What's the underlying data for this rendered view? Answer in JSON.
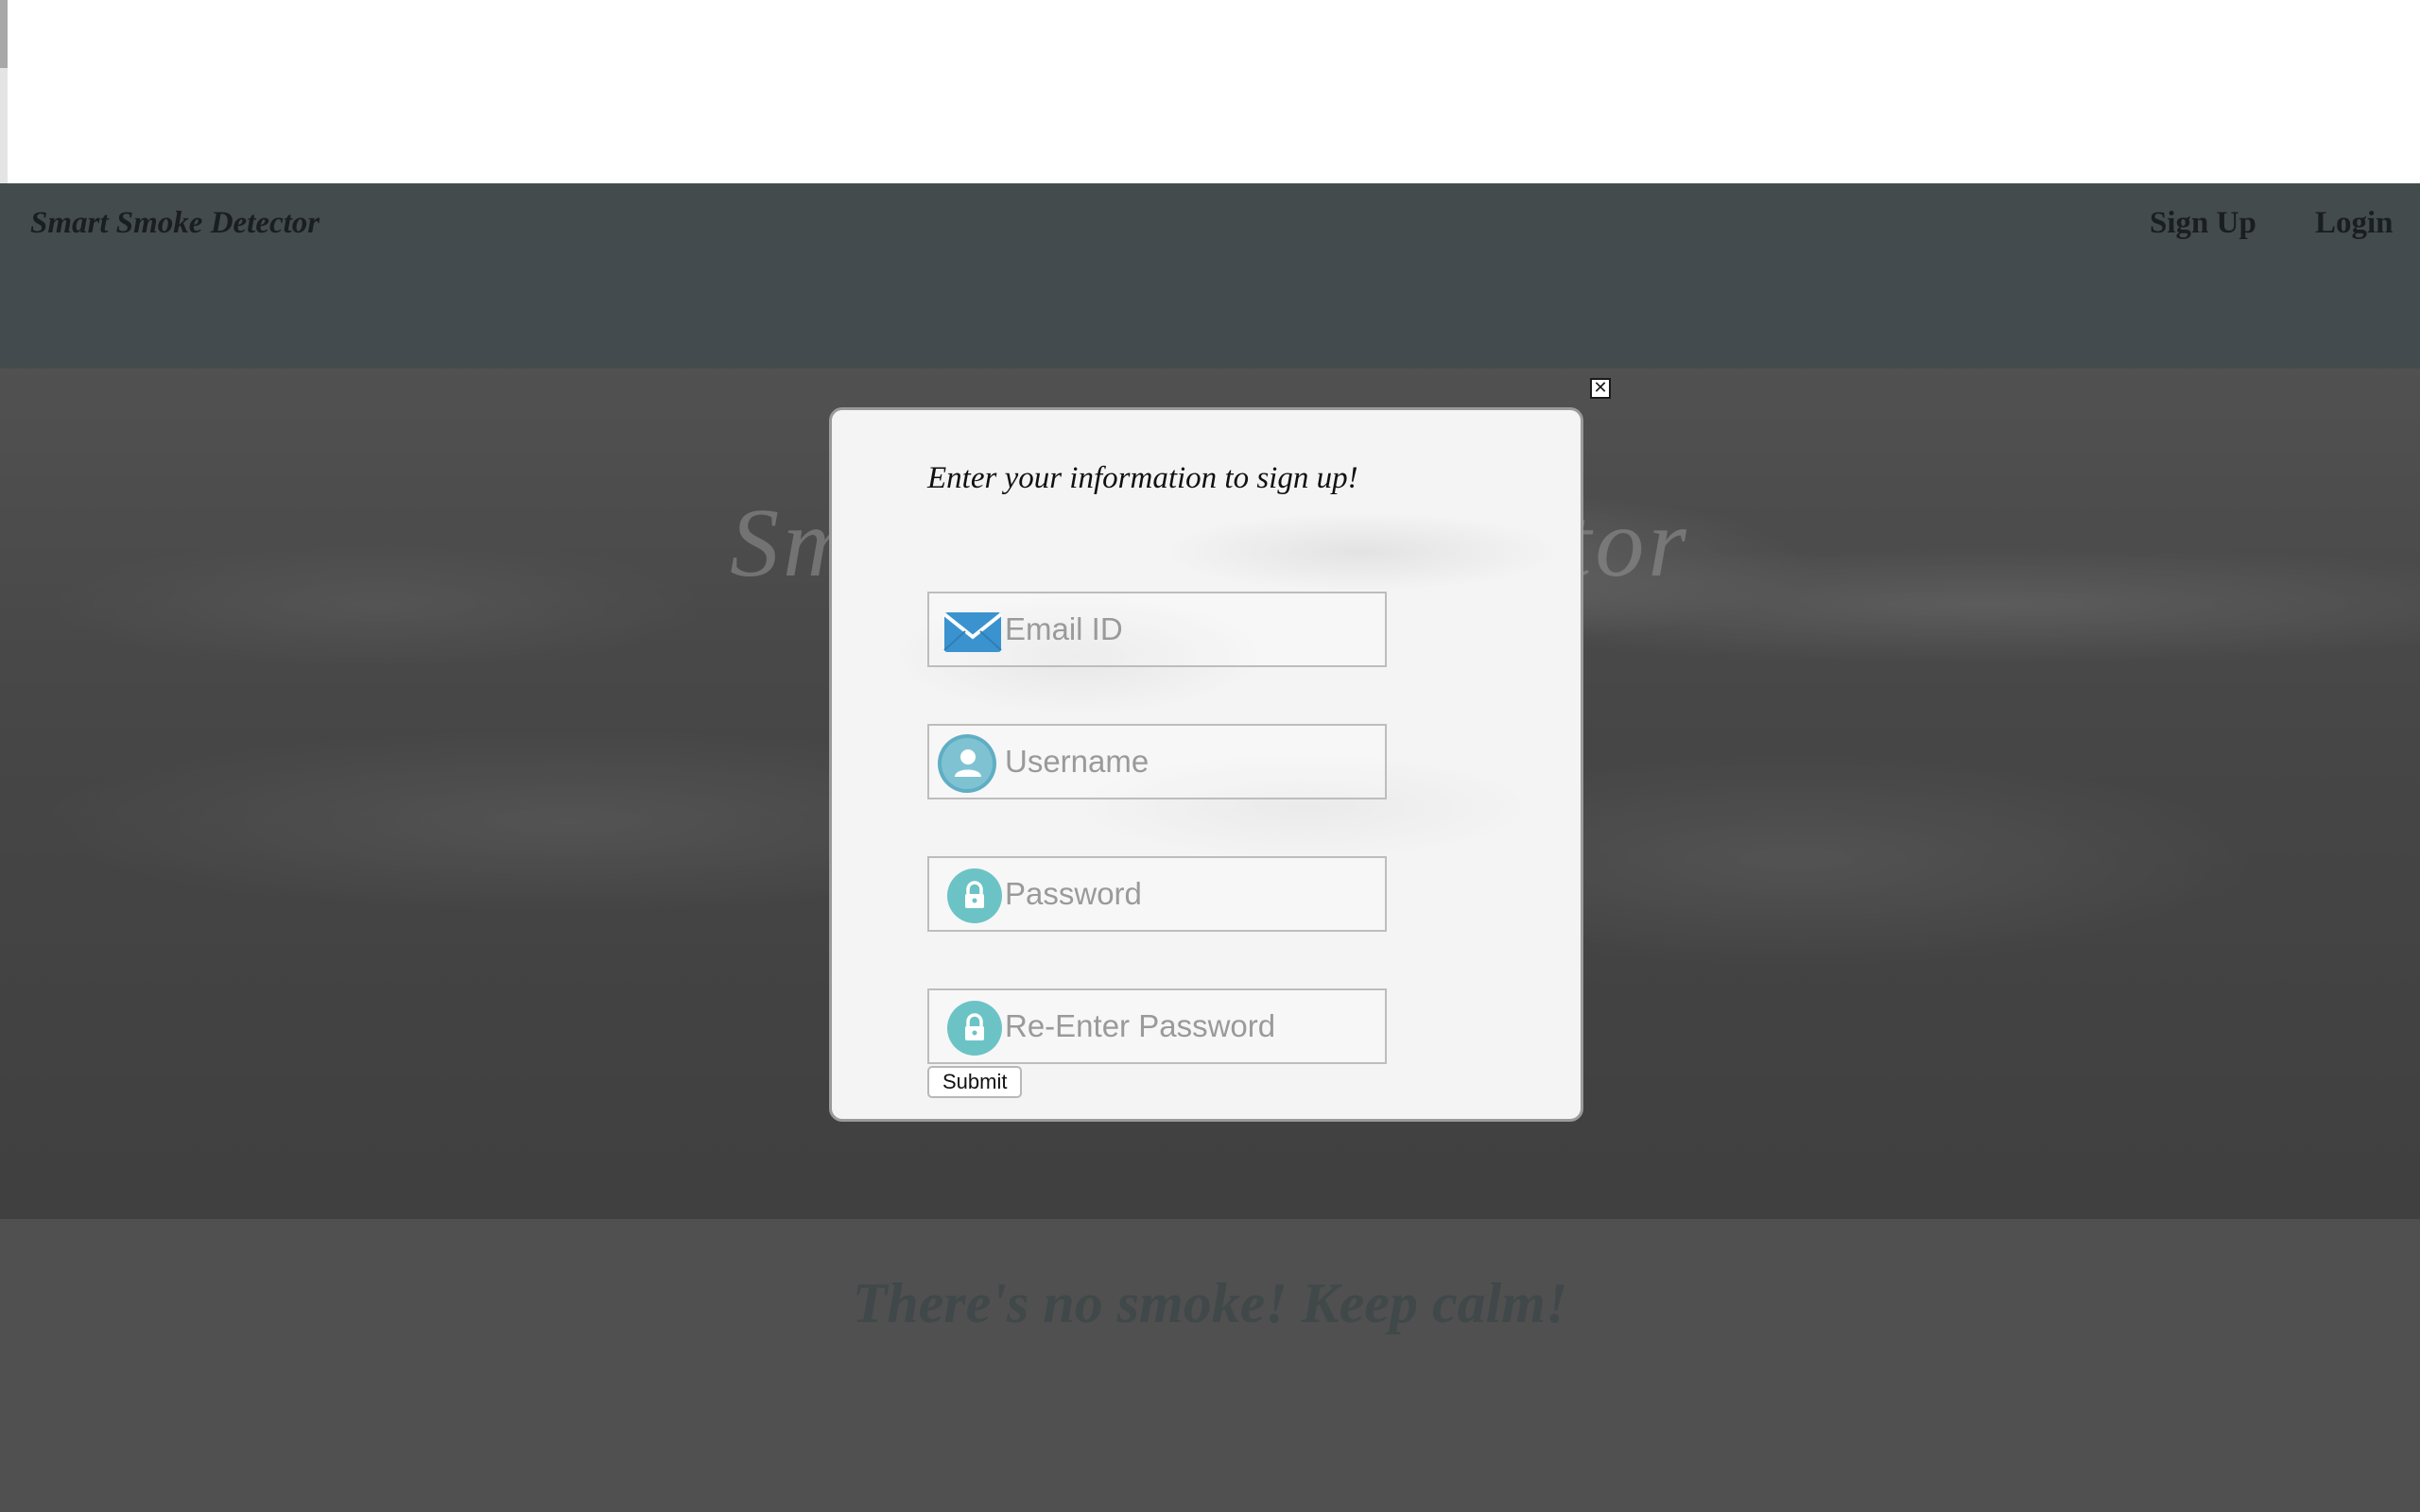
{
  "nav": {
    "brand": "Smart Smoke Detector",
    "signup_label": "Sign Up",
    "login_label": "Login"
  },
  "hero": {
    "title": "Smart Smoke Detector",
    "tagline": "There's no smoke! Keep calm!"
  },
  "modal": {
    "close_icon": "close-icon",
    "heading": "Enter your information to sign up!",
    "fields": {
      "email": {
        "placeholder": "Email ID",
        "value": "",
        "icon": "envelope-icon"
      },
      "username": {
        "placeholder": "Username",
        "value": "",
        "icon": "user-icon"
      },
      "password": {
        "placeholder": "Password",
        "value": "",
        "icon": "lock-icon"
      },
      "repassword": {
        "placeholder": "Re-Enter Password",
        "value": "",
        "icon": "lock-icon"
      }
    },
    "submit_label": "Submit"
  },
  "colors": {
    "navbar": "#758186",
    "nav_text": "#2d3438",
    "icon_blue": "#3a93cf",
    "icon_teal": "#6cc3c6"
  }
}
